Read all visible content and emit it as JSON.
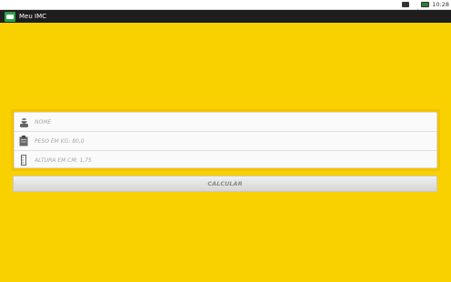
{
  "status_bar": {
    "time": "10:28",
    "icons": [
      "screenshot-icon",
      "signal-icon",
      "battery-icon"
    ]
  },
  "action_bar": {
    "title": "Meu IMC",
    "icon": "app-scale-icon"
  },
  "form": {
    "fields": [
      {
        "icon": "person-icon",
        "placeholder": "NOME",
        "value": ""
      },
      {
        "icon": "clipboard-icon",
        "placeholder": "PESO EM KG: 80,0",
        "value": ""
      },
      {
        "icon": "ruler-icon",
        "placeholder": "ALTURA EM CM: 1,75",
        "value": ""
      }
    ]
  },
  "button": {
    "label": "CALCULAR"
  },
  "colors": {
    "background": "#f9d100",
    "panel": "#f2c400",
    "action_bar": "#1e1e1e",
    "app_icon": "#2f9e4a"
  }
}
